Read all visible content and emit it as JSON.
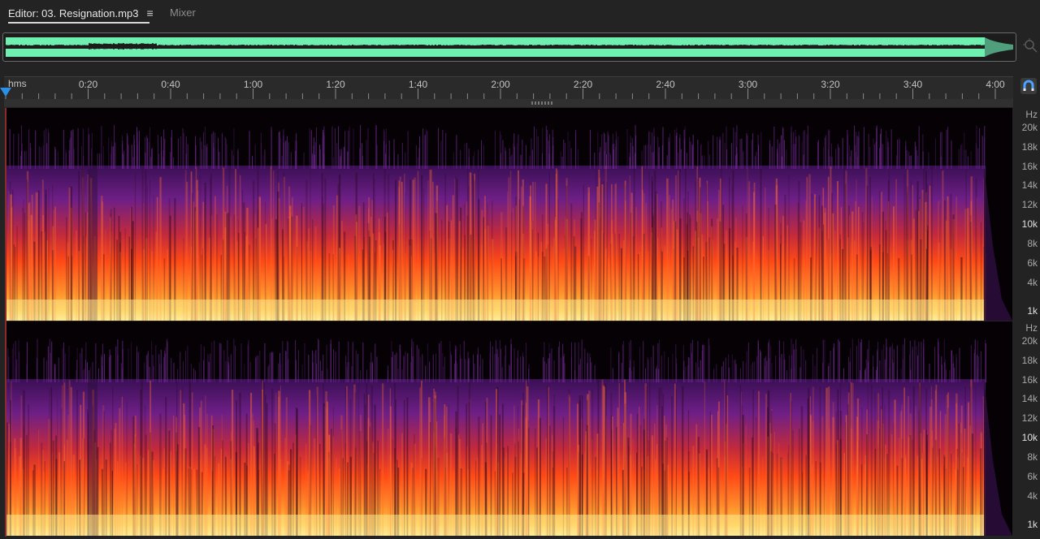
{
  "tabs": {
    "editor_label": "Editor: 03. Resignation.mp3",
    "menu_glyph": "≡",
    "mixer_label": "Mixer"
  },
  "ruler": {
    "format_label": "hms",
    "ticks": [
      "0:20",
      "0:40",
      "1:00",
      "1:20",
      "1:40",
      "2:00",
      "2:20",
      "2:40",
      "3:00",
      "3:20",
      "3:40",
      "4:00"
    ]
  },
  "frequency_scale": {
    "unit_label": "Hz",
    "labels": [
      "20k",
      "18k",
      "16k",
      "14k",
      "12k",
      "10k",
      "8k",
      "6k",
      "4k",
      "1k"
    ]
  },
  "icons": {
    "zoom_navigator": "zoom-navigator-icon",
    "snap": "magnet-snap-icon",
    "playhead": "playhead-marker-icon"
  },
  "colors": {
    "waveform": "#6ff0b0",
    "playhead": "#2d8ee6",
    "spectrum_low": "#ffe07a",
    "spectrum_mid": "#ff5a1a",
    "spectrum_high": "#6e1f86"
  }
}
